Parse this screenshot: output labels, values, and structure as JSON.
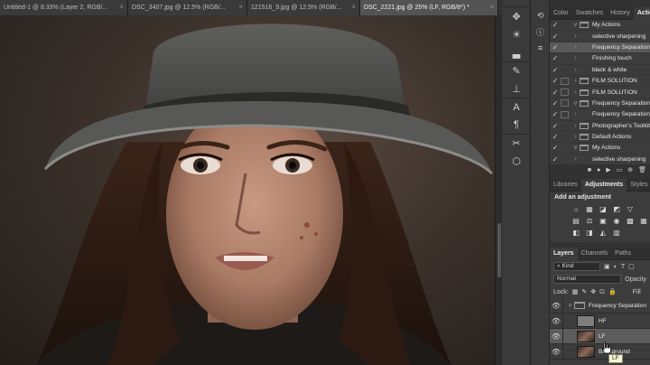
{
  "tabs": [
    {
      "label": "Untitled-1 @ 8.33% (Layer 2, RGB/..."
    },
    {
      "label": "DSC_3407.jpg @ 12.5% (RGB/..."
    },
    {
      "label": "121516_9.jpg @ 12.5% (RGB/..."
    },
    {
      "label": "DSC_2221.jpg @ 25% (LF, RGB/8*) *"
    }
  ],
  "tools": [
    "move-cursor-icon",
    "brightness-icon",
    "histogram-icon",
    "brush-icon",
    "stamp-icon",
    "text-icon",
    "paragraph-icon",
    "crop-icon",
    "3d-cube-icon"
  ],
  "top_panel": {
    "tabs": [
      "Color",
      "Swatches",
      "History",
      "Actions"
    ],
    "active_tab": "Actions"
  },
  "actions": [
    {
      "checked": true,
      "box": false,
      "twisty": "v",
      "folder": true,
      "label": "My Actions"
    },
    {
      "checked": true,
      "box": false,
      "twisty": "›",
      "folder": false,
      "label": "selective sharpening"
    },
    {
      "checked": true,
      "box": false,
      "twisty": "›",
      "folder": false,
      "label": "Frequency Separation",
      "selected": true
    },
    {
      "checked": true,
      "box": false,
      "twisty": "›",
      "folder": false,
      "label": "Finishing touch"
    },
    {
      "checked": true,
      "box": false,
      "twisty": "›",
      "folder": false,
      "label": "black & white"
    },
    {
      "checked": true,
      "box": true,
      "twisty": "›",
      "folder": true,
      "label": "FILM SOLUTION"
    },
    {
      "checked": true,
      "box": true,
      "twisty": "›",
      "folder": true,
      "label": "FILM SOLUTION"
    },
    {
      "checked": true,
      "box": true,
      "twisty": "v",
      "folder": true,
      "label": "Frequency Separation"
    },
    {
      "checked": true,
      "box": true,
      "twisty": "›",
      "folder": false,
      "label": "Frequency Separation"
    },
    {
      "checked": true,
      "box": false,
      "twisty": "›",
      "folder": true,
      "label": "Photographer's Toolkit"
    },
    {
      "checked": true,
      "box": false,
      "twisty": "›",
      "folder": true,
      "label": "Default Actions"
    },
    {
      "checked": true,
      "box": false,
      "twisty": "v",
      "folder": true,
      "label": "My Actions"
    },
    {
      "checked": true,
      "box": false,
      "twisty": "›",
      "folder": false,
      "label": "selective sharpening"
    }
  ],
  "actions_footer_icons": [
    "stop-icon",
    "record-icon",
    "play-icon",
    "new-set-icon",
    "new-action-icon",
    "delete-icon"
  ],
  "adjust_panel": {
    "tabs": [
      "Libraries",
      "Adjustments",
      "Styles"
    ],
    "active_tab": "Adjustments",
    "heading": "Add an adjustment",
    "row1": [
      "☼",
      "▦",
      "◪",
      "◩",
      "▽"
    ],
    "row2": [
      "▤",
      "⚖",
      "▣",
      "◉",
      "▩",
      "▦"
    ],
    "row3": [
      "◧",
      "◨",
      "◭",
      "▥"
    ]
  },
  "layers_panel": {
    "tabs": [
      "Layers",
      "Channels",
      "Paths"
    ],
    "active_tab": "Layers",
    "filter_label": "Kind",
    "blend_mode": "Normal",
    "opacity_label": "Opacity",
    "lock_label": "Lock:",
    "fill_label": "Fill",
    "layers": [
      {
        "name": "Frequency Separation",
        "kind": "group",
        "selected": false
      },
      {
        "name": "HF",
        "kind": "gray",
        "selected": false
      },
      {
        "name": "LF",
        "kind": "photo",
        "selected": true
      },
      {
        "name": "Background",
        "kind": "photo",
        "selected": false
      }
    ],
    "tooltip": "LF"
  },
  "colors": {
    "accent_selected": "#5c5c5c",
    "tooltip_bg": "#f4f4d2"
  }
}
